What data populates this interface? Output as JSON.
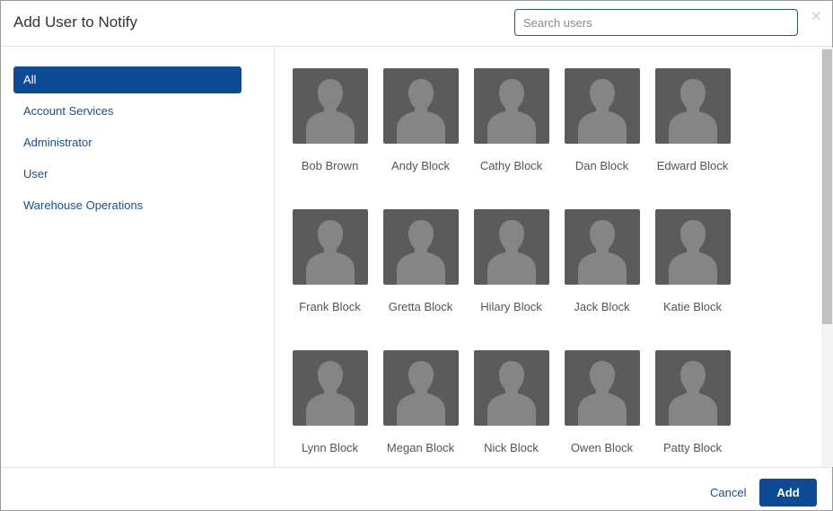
{
  "dialog": {
    "title": "Add User to Notify",
    "close_icon": "close-icon",
    "search": {
      "placeholder": "Search users",
      "value": ""
    }
  },
  "sidebar": {
    "items": [
      {
        "label": "All",
        "active": true
      },
      {
        "label": "Account Services",
        "active": false
      },
      {
        "label": "Administrator",
        "active": false
      },
      {
        "label": "User",
        "active": false
      },
      {
        "label": "Warehouse Operations",
        "active": false
      }
    ]
  },
  "users": [
    {
      "name": "Bob Brown",
      "icon": "user-avatar-icon"
    },
    {
      "name": "Andy Block",
      "icon": "user-avatar-icon"
    },
    {
      "name": "Cathy Block",
      "icon": "user-avatar-icon"
    },
    {
      "name": "Dan Block",
      "icon": "user-avatar-icon"
    },
    {
      "name": "Edward Block",
      "icon": "user-avatar-icon"
    },
    {
      "name": "Frank Block",
      "icon": "user-avatar-icon"
    },
    {
      "name": "Gretta Block",
      "icon": "user-avatar-icon"
    },
    {
      "name": "Hilary Block",
      "icon": "user-avatar-icon"
    },
    {
      "name": "Jack Block",
      "icon": "user-avatar-icon"
    },
    {
      "name": "Katie Block",
      "icon": "user-avatar-icon"
    },
    {
      "name": "Lynn Block",
      "icon": "user-avatar-icon"
    },
    {
      "name": "Megan Block",
      "icon": "user-avatar-icon"
    },
    {
      "name": "Nick Block",
      "icon": "user-avatar-icon"
    },
    {
      "name": "Owen Block",
      "icon": "user-avatar-icon"
    },
    {
      "name": "Patty Block",
      "icon": "user-avatar-icon"
    }
  ],
  "footer": {
    "cancel_label": "Cancel",
    "add_label": "Add"
  },
  "colors": {
    "accent": "#0f4a97",
    "link": "#1f4e86",
    "avatar_bg": "#5b5b5b",
    "avatar_silhouette": "#858585"
  }
}
